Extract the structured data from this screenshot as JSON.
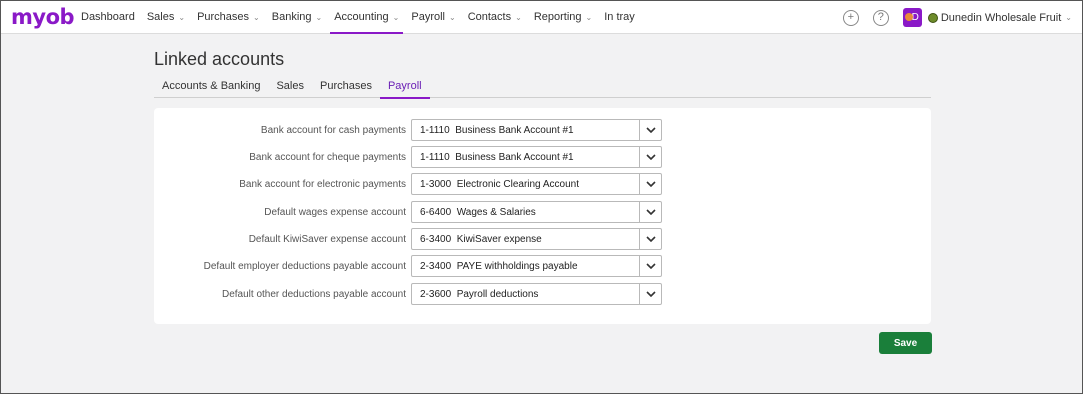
{
  "brand": {
    "logo_text": "myob",
    "accent": "#8a19c7"
  },
  "nav": {
    "items": [
      {
        "label": "Dashboard",
        "dropdown": false,
        "active": false
      },
      {
        "label": "Sales",
        "dropdown": true,
        "active": false
      },
      {
        "label": "Purchases",
        "dropdown": true,
        "active": false
      },
      {
        "label": "Banking",
        "dropdown": true,
        "active": false
      },
      {
        "label": "Accounting",
        "dropdown": true,
        "active": true
      },
      {
        "label": "Payroll",
        "dropdown": true,
        "active": false
      },
      {
        "label": "Contacts",
        "dropdown": true,
        "active": false
      },
      {
        "label": "Reporting",
        "dropdown": true,
        "active": false
      },
      {
        "label": "In tray",
        "dropdown": false,
        "active": false
      }
    ],
    "icons": {
      "create": "plus-circle-icon",
      "help": "help-circle-icon",
      "chevron": "chevron-down-icon"
    },
    "avatar_initial": "D",
    "business_name": "Dunedin Wholesale Fruit"
  },
  "page": {
    "title": "Linked accounts"
  },
  "tabs": [
    {
      "label": "Accounts & Banking",
      "active": false
    },
    {
      "label": "Sales",
      "active": false
    },
    {
      "label": "Purchases",
      "active": false
    },
    {
      "label": "Payroll",
      "active": true
    }
  ],
  "fields": [
    {
      "label": "Bank account for cash payments",
      "value": "1-1110  Business Bank Account #1"
    },
    {
      "label": "Bank account for cheque payments",
      "value": "1-1110  Business Bank Account #1"
    },
    {
      "label": "Bank account for electronic payments",
      "value": "1-3000  Electronic Clearing Account"
    },
    {
      "label": "Default wages expense account",
      "value": "6-6400  Wages & Salaries"
    },
    {
      "label": "Default KiwiSaver expense account",
      "value": "6-3400  KiwiSaver expense"
    },
    {
      "label": "Default employer deductions payable account",
      "value": "2-3400  PAYE withholdings payable"
    },
    {
      "label": "Default other deductions payable account",
      "value": "2-3600  Payroll deductions"
    }
  ],
  "actions": {
    "save_label": "Save",
    "save_color": "#1a7f3a"
  }
}
